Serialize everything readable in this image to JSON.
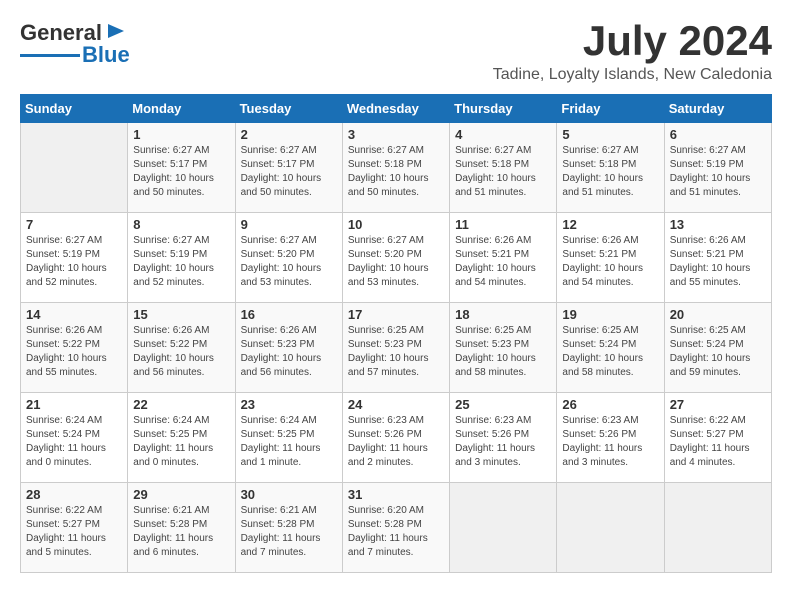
{
  "header": {
    "logo_line1": "General",
    "logo_line2": "Blue",
    "month": "July 2024",
    "location": "Tadine, Loyalty Islands, New Caledonia"
  },
  "weekdays": [
    "Sunday",
    "Monday",
    "Tuesday",
    "Wednesday",
    "Thursday",
    "Friday",
    "Saturday"
  ],
  "weeks": [
    [
      {
        "day": "",
        "empty": true
      },
      {
        "day": "1",
        "sunrise": "6:27 AM",
        "sunset": "5:17 PM",
        "daylight": "10 hours and 50 minutes."
      },
      {
        "day": "2",
        "sunrise": "6:27 AM",
        "sunset": "5:17 PM",
        "daylight": "10 hours and 50 minutes."
      },
      {
        "day": "3",
        "sunrise": "6:27 AM",
        "sunset": "5:18 PM",
        "daylight": "10 hours and 50 minutes."
      },
      {
        "day": "4",
        "sunrise": "6:27 AM",
        "sunset": "5:18 PM",
        "daylight": "10 hours and 51 minutes."
      },
      {
        "day": "5",
        "sunrise": "6:27 AM",
        "sunset": "5:18 PM",
        "daylight": "10 hours and 51 minutes."
      },
      {
        "day": "6",
        "sunrise": "6:27 AM",
        "sunset": "5:19 PM",
        "daylight": "10 hours and 51 minutes."
      }
    ],
    [
      {
        "day": "7",
        "sunrise": "6:27 AM",
        "sunset": "5:19 PM",
        "daylight": "10 hours and 52 minutes."
      },
      {
        "day": "8",
        "sunrise": "6:27 AM",
        "sunset": "5:19 PM",
        "daylight": "10 hours and 52 minutes."
      },
      {
        "day": "9",
        "sunrise": "6:27 AM",
        "sunset": "5:20 PM",
        "daylight": "10 hours and 53 minutes."
      },
      {
        "day": "10",
        "sunrise": "6:27 AM",
        "sunset": "5:20 PM",
        "daylight": "10 hours and 53 minutes."
      },
      {
        "day": "11",
        "sunrise": "6:26 AM",
        "sunset": "5:21 PM",
        "daylight": "10 hours and 54 minutes."
      },
      {
        "day": "12",
        "sunrise": "6:26 AM",
        "sunset": "5:21 PM",
        "daylight": "10 hours and 54 minutes."
      },
      {
        "day": "13",
        "sunrise": "6:26 AM",
        "sunset": "5:21 PM",
        "daylight": "10 hours and 55 minutes."
      }
    ],
    [
      {
        "day": "14",
        "sunrise": "6:26 AM",
        "sunset": "5:22 PM",
        "daylight": "10 hours and 55 minutes."
      },
      {
        "day": "15",
        "sunrise": "6:26 AM",
        "sunset": "5:22 PM",
        "daylight": "10 hours and 56 minutes."
      },
      {
        "day": "16",
        "sunrise": "6:26 AM",
        "sunset": "5:23 PM",
        "daylight": "10 hours and 56 minutes."
      },
      {
        "day": "17",
        "sunrise": "6:25 AM",
        "sunset": "5:23 PM",
        "daylight": "10 hours and 57 minutes."
      },
      {
        "day": "18",
        "sunrise": "6:25 AM",
        "sunset": "5:23 PM",
        "daylight": "10 hours and 58 minutes."
      },
      {
        "day": "19",
        "sunrise": "6:25 AM",
        "sunset": "5:24 PM",
        "daylight": "10 hours and 58 minutes."
      },
      {
        "day": "20",
        "sunrise": "6:25 AM",
        "sunset": "5:24 PM",
        "daylight": "10 hours and 59 minutes."
      }
    ],
    [
      {
        "day": "21",
        "sunrise": "6:24 AM",
        "sunset": "5:24 PM",
        "daylight": "11 hours and 0 minutes."
      },
      {
        "day": "22",
        "sunrise": "6:24 AM",
        "sunset": "5:25 PM",
        "daylight": "11 hours and 0 minutes."
      },
      {
        "day": "23",
        "sunrise": "6:24 AM",
        "sunset": "5:25 PM",
        "daylight": "11 hours and 1 minute."
      },
      {
        "day": "24",
        "sunrise": "6:23 AM",
        "sunset": "5:26 PM",
        "daylight": "11 hours and 2 minutes."
      },
      {
        "day": "25",
        "sunrise": "6:23 AM",
        "sunset": "5:26 PM",
        "daylight": "11 hours and 3 minutes."
      },
      {
        "day": "26",
        "sunrise": "6:23 AM",
        "sunset": "5:26 PM",
        "daylight": "11 hours and 3 minutes."
      },
      {
        "day": "27",
        "sunrise": "6:22 AM",
        "sunset": "5:27 PM",
        "daylight": "11 hours and 4 minutes."
      }
    ],
    [
      {
        "day": "28",
        "sunrise": "6:22 AM",
        "sunset": "5:27 PM",
        "daylight": "11 hours and 5 minutes."
      },
      {
        "day": "29",
        "sunrise": "6:21 AM",
        "sunset": "5:28 PM",
        "daylight": "11 hours and 6 minutes."
      },
      {
        "day": "30",
        "sunrise": "6:21 AM",
        "sunset": "5:28 PM",
        "daylight": "11 hours and 7 minutes."
      },
      {
        "day": "31",
        "sunrise": "6:20 AM",
        "sunset": "5:28 PM",
        "daylight": "11 hours and 7 minutes."
      },
      {
        "day": "",
        "empty": true
      },
      {
        "day": "",
        "empty": true
      },
      {
        "day": "",
        "empty": true
      }
    ]
  ]
}
